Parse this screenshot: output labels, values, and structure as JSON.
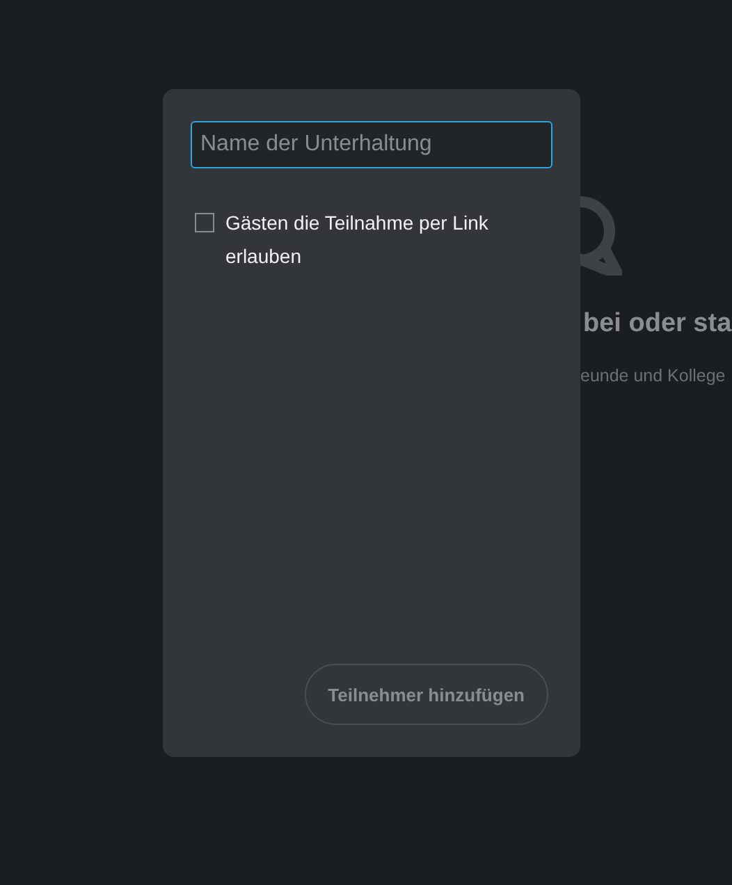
{
  "background": {
    "heading": "bei oder sta",
    "subtext": "eunde und Kollege"
  },
  "dialog": {
    "name_field": {
      "placeholder": "Name der Unterhaltung",
      "focused": true
    },
    "guest_option": {
      "label": "Gästen die Teilnahme per Link erlauben",
      "checked": false
    },
    "add_button": {
      "label": "Teilnehmer hinzufügen",
      "disabled": true
    }
  }
}
